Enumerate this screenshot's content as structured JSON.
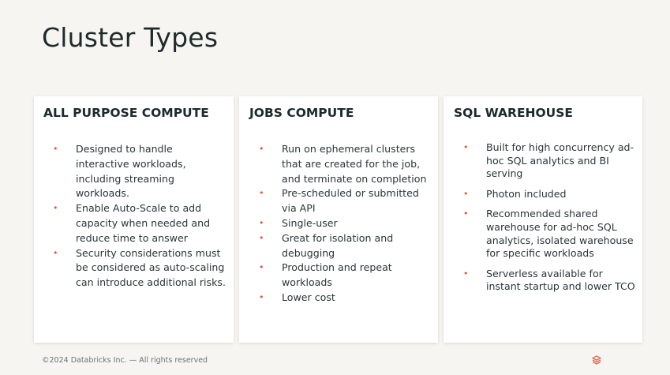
{
  "slide": {
    "title": "Cluster Types"
  },
  "panels": [
    {
      "heading": "ALL PURPOSE COMPUTE",
      "items": [
        "Designed to handle interactive workloads, including streaming workloads.",
        "Enable Auto-Scale to add capacity when needed and reduce time to answer",
        "Security considerations must be considered as auto-scaling can introduce additional risks."
      ]
    },
    {
      "heading": "JOBS COMPUTE",
      "items": [
        "Run on ephemeral clusters that are created for the job, and terminate on completion",
        "Pre-scheduled or submitted via API",
        "Single-user",
        "Great for isolation and debugging",
        "Production and repeat workloads",
        "Lower cost"
      ]
    },
    {
      "heading": "SQL WAREHOUSE",
      "items": [
        "Built for high concurrency ad-hoc SQL analytics and BI serving",
        "Photon included",
        "Recommended shared warehouse for ad-hoc SQL analytics, isolated warehouse for specific workloads",
        "Serverless available for instant startup and lower TCO"
      ]
    }
  ],
  "footer": {
    "copyright": "©2024 Databricks Inc. — All rights reserved",
    "logo_icon": "databricks-logo-icon"
  },
  "colors": {
    "background": "#f6f5f1",
    "panel": "#ffffff",
    "bullet": "#e0543c",
    "title_text": "#1e2a2c"
  }
}
